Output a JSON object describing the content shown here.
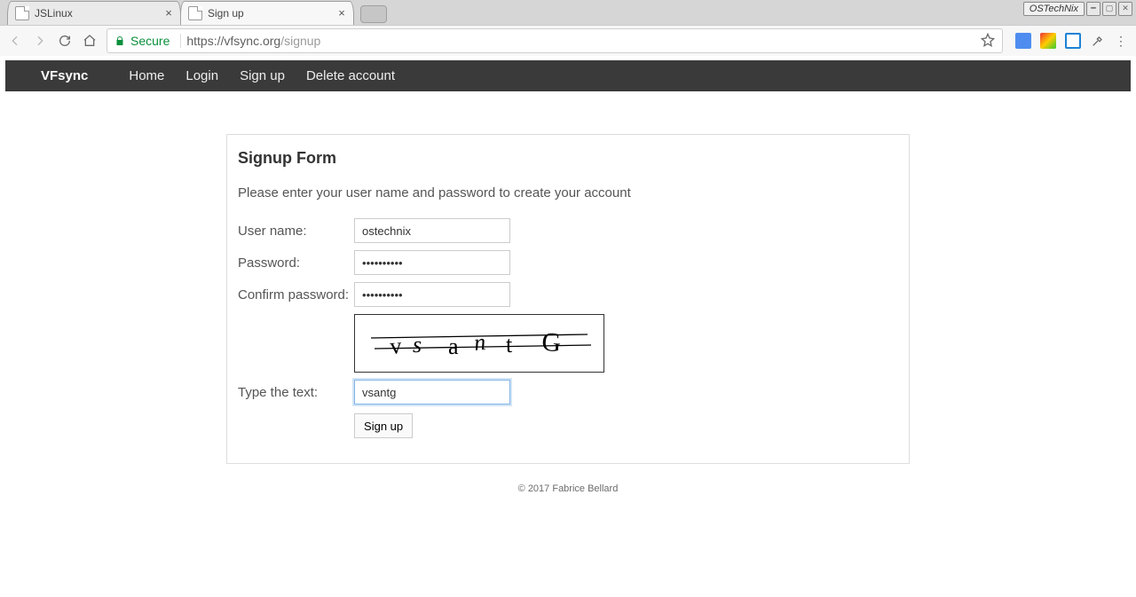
{
  "browser": {
    "tabs": [
      {
        "title": "JSLinux",
        "active": false
      },
      {
        "title": "Sign up",
        "active": true
      }
    ],
    "secure_label": "Secure",
    "url_scheme": "https://",
    "url_host": "vfsync.org",
    "url_path": "/signup",
    "os_badge": "OSTechNix"
  },
  "navbar": {
    "brand": "VFsync",
    "links": [
      "Home",
      "Login",
      "Sign up",
      "Delete account"
    ]
  },
  "form": {
    "heading": "Signup Form",
    "instructions": "Please enter your user name and password to create your account",
    "labels": {
      "username": "User name:",
      "password": "Password:",
      "confirm": "Confirm password:",
      "captcha": "Type the text:"
    },
    "values": {
      "username": "ostechnix",
      "password": "••••••••••",
      "confirm": "••••••••••",
      "captcha": "vsantg"
    },
    "submit_label": "Sign up",
    "captcha_glyphs": "v s a n t G"
  },
  "footer": "© 2017 Fabrice Bellard"
}
